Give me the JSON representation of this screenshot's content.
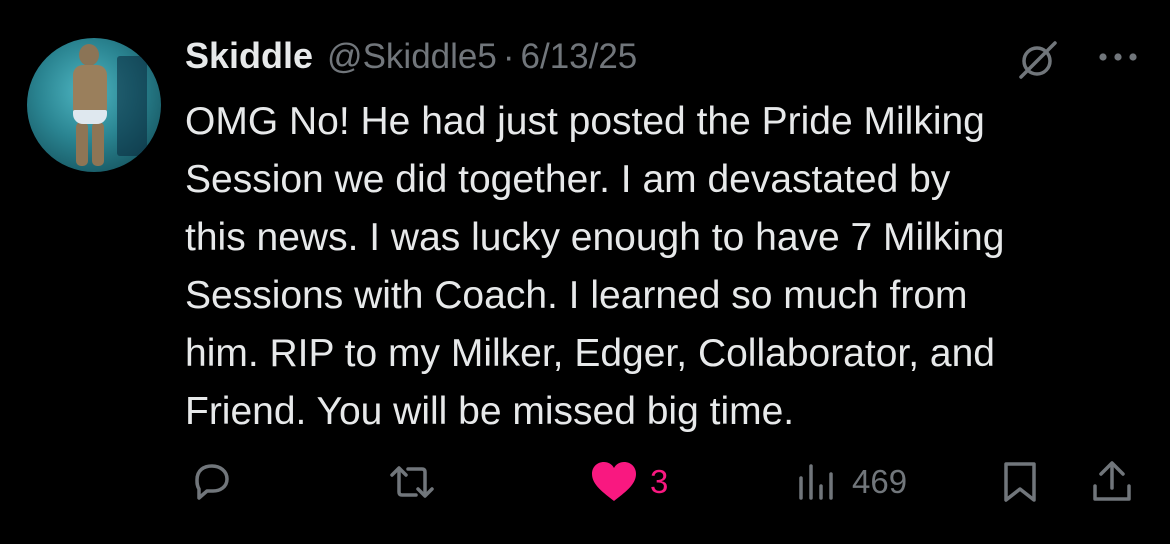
{
  "post": {
    "author": {
      "name": "Skiddle",
      "handle": "@Skiddle5"
    },
    "separator": "·",
    "date": "6/13/25",
    "text": "OMG No! He had just posted the Pride Milking\nSession we did together. I am devastated by\nthis news. I was lucky enough to have 7 Milking\nSessions with Coach. I learned so much from\nhim. RIP to my Milker, Edger, Collaborator, and\nFriend. You will be missed big time."
  },
  "actions": {
    "reply": {
      "icon": "reply-icon"
    },
    "repost": {
      "icon": "repost-icon"
    },
    "like": {
      "icon": "heart-icon",
      "count": "3",
      "liked": true,
      "color": "#f91880"
    },
    "views": {
      "icon": "views-icon",
      "count": "469"
    },
    "bookmark": {
      "icon": "bookmark-icon"
    },
    "share": {
      "icon": "share-icon"
    }
  },
  "colors": {
    "background": "#000000",
    "text": "#e7e9ea",
    "muted": "#71767b",
    "like": "#f91880"
  }
}
